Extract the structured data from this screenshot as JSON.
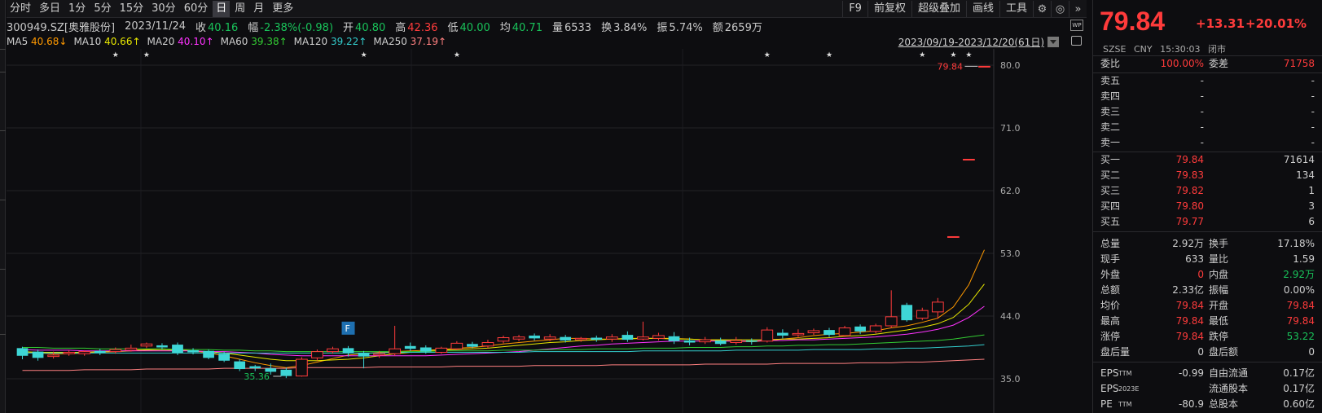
{
  "toolbar": {
    "periods": [
      "分时",
      "多日",
      "1分",
      "5分",
      "15分",
      "30分",
      "60分",
      "日",
      "周",
      "月",
      "更多"
    ],
    "active_period": "日",
    "right_buttons": [
      "F9",
      "前复权",
      "超级叠加",
      "画线",
      "工具"
    ],
    "icons": [
      "gear-icon",
      "compass-icon",
      "double-chevron-right-icon"
    ]
  },
  "info": {
    "code": "300949.SZ[奥雅股份]",
    "date": "2023/11/24",
    "close_label": "收",
    "close": "40.16",
    "amp_label": "幅",
    "amp": "-2.38%(-0.98)",
    "open_label": "开",
    "open": "40.80",
    "high_label": "高",
    "high": "42.36",
    "low_label": "低",
    "low": "40.00",
    "avg_label": "均",
    "avg": "40.71",
    "vol_label": "量",
    "vol": "6533",
    "turnover_label": "换",
    "turnover": "3.84%",
    "swing_label": "振",
    "swing": "5.74%",
    "amount_label": "额",
    "amount": "2659万",
    "wp_icon": "WP"
  },
  "ma": [
    {
      "label": "MA5",
      "value": "40.68↓",
      "color": "#ff9900"
    },
    {
      "label": "MA10",
      "value": "40.66↑",
      "color": "#e8e800"
    },
    {
      "label": "MA20",
      "value": "40.10↑",
      "color": "#ff33ff"
    },
    {
      "label": "MA60",
      "value": "39.38↑",
      "color": "#33cc33"
    },
    {
      "label": "MA120",
      "value": "39.22↑",
      "color": "#33cccc"
    },
    {
      "label": "MA250",
      "value": "37.19↑",
      "color": "#ff8080"
    }
  ],
  "date_range": "2023/09/19-2023/12/20(61日)",
  "chart_data": {
    "type": "candlestick",
    "y_ticks": [
      "80.0",
      "71.0",
      "62.0",
      "53.0",
      "44.0",
      "35.0"
    ],
    "ylim": [
      35.0,
      80.0
    ],
    "last_price_label": "79.84",
    "min_price_label": "35.36",
    "f_marker": "F",
    "up_color": "#ff3b3b",
    "down_color": "#3ed6d6",
    "star_marks": [
      "★",
      "★",
      "★",
      "★",
      "★",
      "★",
      "★",
      "★",
      "★"
    ],
    "candles": [
      {
        "o": 39.4,
        "c": 38.3,
        "h": 39.6,
        "l": 37.8
      },
      {
        "o": 38.9,
        "c": 38.0,
        "h": 39.2,
        "l": 37.6
      },
      {
        "o": 38.2,
        "c": 38.4,
        "h": 38.9,
        "l": 37.9
      },
      {
        "o": 38.6,
        "c": 38.8,
        "h": 39.1,
        "l": 38.3
      },
      {
        "o": 38.6,
        "c": 38.9,
        "h": 39.1,
        "l": 38.3
      },
      {
        "o": 39.0,
        "c": 38.7,
        "h": 39.3,
        "l": 38.4
      },
      {
        "o": 38.9,
        "c": 39.2,
        "h": 39.5,
        "l": 38.6
      },
      {
        "o": 39.1,
        "c": 39.4,
        "h": 39.9,
        "l": 38.9
      },
      {
        "o": 39.7,
        "c": 40.0,
        "h": 40.2,
        "l": 39.4
      },
      {
        "o": 39.8,
        "c": 39.5,
        "h": 40.1,
        "l": 39.2
      },
      {
        "o": 39.9,
        "c": 38.7,
        "h": 40.2,
        "l": 38.4
      },
      {
        "o": 39.1,
        "c": 38.8,
        "h": 39.4,
        "l": 38.5
      },
      {
        "o": 39.0,
        "c": 38.0,
        "h": 39.2,
        "l": 37.8
      },
      {
        "o": 38.6,
        "c": 37.6,
        "h": 38.9,
        "l": 37.4
      },
      {
        "o": 37.5,
        "c": 36.4,
        "h": 37.8,
        "l": 36.1
      },
      {
        "o": 36.8,
        "c": 36.5,
        "h": 37.0,
        "l": 36.1
      },
      {
        "o": 36.5,
        "c": 36.0,
        "h": 37.2,
        "l": 35.6
      },
      {
        "o": 36.3,
        "c": 35.4,
        "h": 36.6,
        "l": 35.1
      },
      {
        "o": 35.4,
        "c": 37.8,
        "h": 38.1,
        "l": 35.3
      },
      {
        "o": 38.0,
        "c": 38.9,
        "h": 39.2,
        "l": 37.6
      },
      {
        "o": 38.9,
        "c": 39.3,
        "h": 39.6,
        "l": 38.6
      },
      {
        "o": 39.4,
        "c": 38.7,
        "h": 39.7,
        "l": 38.2
      },
      {
        "o": 38.7,
        "c": 38.2,
        "h": 39.0,
        "l": 36.5
      },
      {
        "o": 38.4,
        "c": 38.6,
        "h": 39.0,
        "l": 38.0
      },
      {
        "o": 38.6,
        "c": 39.3,
        "h": 42.6,
        "l": 38.3
      },
      {
        "o": 39.7,
        "c": 39.3,
        "h": 40.2,
        "l": 39.0
      },
      {
        "o": 39.5,
        "c": 38.9,
        "h": 39.8,
        "l": 38.6
      },
      {
        "o": 38.8,
        "c": 39.4,
        "h": 39.6,
        "l": 38.6
      },
      {
        "o": 39.3,
        "c": 40.1,
        "h": 40.4,
        "l": 39.1
      },
      {
        "o": 40.0,
        "c": 39.6,
        "h": 40.3,
        "l": 39.4
      },
      {
        "o": 39.7,
        "c": 40.2,
        "h": 40.6,
        "l": 39.4
      },
      {
        "o": 40.4,
        "c": 40.9,
        "h": 41.2,
        "l": 40.1
      },
      {
        "o": 40.7,
        "c": 41.0,
        "h": 41.3,
        "l": 40.4
      },
      {
        "o": 41.2,
        "c": 40.8,
        "h": 41.5,
        "l": 40.5
      },
      {
        "o": 40.7,
        "c": 41.0,
        "h": 41.4,
        "l": 40.4
      },
      {
        "o": 41.0,
        "c": 40.5,
        "h": 41.3,
        "l": 40.2
      },
      {
        "o": 40.6,
        "c": 40.8,
        "h": 41.0,
        "l": 40.3
      },
      {
        "o": 40.9,
        "c": 40.6,
        "h": 41.2,
        "l": 40.3
      },
      {
        "o": 40.7,
        "c": 41.0,
        "h": 41.4,
        "l": 40.3
      },
      {
        "o": 41.3,
        "c": 40.6,
        "h": 41.8,
        "l": 40.3
      },
      {
        "o": 40.7,
        "c": 41.0,
        "h": 43.2,
        "l": 40.5
      },
      {
        "o": 40.8,
        "c": 41.2,
        "h": 41.6,
        "l": 40.5
      },
      {
        "o": 41.1,
        "c": 40.4,
        "h": 41.7,
        "l": 40.0
      },
      {
        "o": 40.5,
        "c": 40.2,
        "h": 40.9,
        "l": 39.8
      },
      {
        "o": 40.3,
        "c": 40.6,
        "h": 41.0,
        "l": 40.0
      },
      {
        "o": 40.5,
        "c": 40.0,
        "h": 40.9,
        "l": 39.8
      },
      {
        "o": 40.2,
        "c": 40.5,
        "h": 41.0,
        "l": 39.9
      },
      {
        "o": 40.5,
        "c": 40.3,
        "h": 40.8,
        "l": 39.9
      },
      {
        "o": 40.4,
        "c": 42.0,
        "h": 42.4,
        "l": 40.2
      },
      {
        "o": 41.6,
        "c": 41.2,
        "h": 42.1,
        "l": 40.8
      },
      {
        "o": 41.3,
        "c": 41.5,
        "h": 42.1,
        "l": 41.0
      },
      {
        "o": 41.6,
        "c": 41.9,
        "h": 42.2,
        "l": 41.3
      },
      {
        "o": 42.0,
        "c": 41.3,
        "h": 42.3,
        "l": 41.0
      },
      {
        "o": 41.2,
        "c": 42.3,
        "h": 42.6,
        "l": 41.0
      },
      {
        "o": 42.5,
        "c": 41.8,
        "h": 42.8,
        "l": 41.4
      },
      {
        "o": 41.8,
        "c": 42.6,
        "h": 42.9,
        "l": 41.5
      },
      {
        "o": 42.6,
        "c": 43.9,
        "h": 47.7,
        "l": 42.3
      },
      {
        "o": 45.6,
        "c": 43.4,
        "h": 45.9,
        "l": 43.2
      },
      {
        "o": 43.7,
        "c": 44.8,
        "h": 45.2,
        "l": 43.4
      },
      {
        "o": 44.6,
        "c": 46.0,
        "h": 46.6,
        "l": 43.6
      },
      {
        "o": 55.4,
        "c": 55.4,
        "h": 55.4,
        "l": 55.4
      },
      {
        "o": 66.5,
        "c": 66.5,
        "h": 66.5,
        "l": 66.5
      },
      {
        "o": 79.84,
        "c": 79.84,
        "h": 79.84,
        "l": 79.84
      }
    ],
    "ma_lines": {
      "ma5": [
        38.9,
        38.7,
        38.6,
        38.6,
        38.7,
        38.8,
        38.9,
        39.1,
        39.2,
        39.3,
        39.2,
        39.0,
        38.7,
        38.3,
        37.8,
        37.3,
        36.9,
        36.6,
        36.9,
        37.4,
        37.9,
        38.4,
        38.6,
        38.8,
        38.9,
        39.0,
        39.1,
        39.2,
        39.4,
        39.5,
        39.7,
        40.0,
        40.2,
        40.4,
        40.6,
        40.8,
        40.8,
        40.7,
        40.7,
        40.7,
        40.8,
        40.8,
        40.8,
        40.7,
        40.6,
        40.5,
        40.4,
        40.3,
        40.5,
        40.7,
        40.9,
        41.2,
        41.4,
        41.5,
        41.7,
        41.9,
        42.3,
        42.6,
        43.1,
        43.7,
        45.3,
        48.5,
        53.5
      ],
      "ma10": [
        38.9,
        38.8,
        38.8,
        38.8,
        38.8,
        38.9,
        38.9,
        39.0,
        39.1,
        39.1,
        39.1,
        39.0,
        38.9,
        38.7,
        38.4,
        38.1,
        37.8,
        37.6,
        37.6,
        37.6,
        37.7,
        37.8,
        38.0,
        38.3,
        38.6,
        38.8,
        39.0,
        39.1,
        39.2,
        39.3,
        39.4,
        39.6,
        39.8,
        40.0,
        40.2,
        40.3,
        40.5,
        40.6,
        40.7,
        40.8,
        40.8,
        40.8,
        40.7,
        40.7,
        40.6,
        40.6,
        40.6,
        40.6,
        40.6,
        40.7,
        40.7,
        40.8,
        40.9,
        41.1,
        41.2,
        41.4,
        41.7,
        42.0,
        42.4,
        42.9,
        43.8,
        45.7,
        48.6
      ],
      "ma20": [
        39.2,
        39.1,
        39.1,
        39.1,
        39.0,
        39.0,
        39.0,
        39.0,
        39.0,
        39.0,
        39.0,
        39.0,
        38.9,
        38.9,
        38.8,
        38.7,
        38.5,
        38.4,
        38.3,
        38.3,
        38.3,
        38.3,
        38.3,
        38.3,
        38.3,
        38.3,
        38.3,
        38.4,
        38.5,
        38.6,
        38.7,
        38.8,
        38.9,
        39.1,
        39.3,
        39.5,
        39.7,
        39.8,
        40.0,
        40.1,
        40.2,
        40.3,
        40.4,
        40.4,
        40.4,
        40.4,
        40.4,
        40.4,
        40.5,
        40.5,
        40.6,
        40.6,
        40.7,
        40.8,
        40.9,
        41.0,
        41.2,
        41.4,
        41.7,
        42.1,
        42.7,
        43.8,
        45.4
      ],
      "ma60": [
        39.5,
        39.5,
        39.4,
        39.4,
        39.4,
        39.3,
        39.3,
        39.3,
        39.3,
        39.3,
        39.2,
        39.2,
        39.2,
        39.1,
        39.1,
        39.0,
        39.0,
        38.9,
        38.9,
        38.9,
        38.9,
        38.9,
        38.9,
        38.9,
        38.9,
        38.9,
        38.9,
        39.0,
        39.0,
        39.0,
        39.0,
        39.1,
        39.1,
        39.1,
        39.2,
        39.2,
        39.2,
        39.3,
        39.3,
        39.3,
        39.4,
        39.4,
        39.4,
        39.5,
        39.5,
        39.5,
        39.6,
        39.6,
        39.7,
        39.7,
        39.8,
        39.8,
        39.9,
        39.9,
        40.0,
        40.1,
        40.2,
        40.3,
        40.4,
        40.5,
        40.7,
        41.0,
        41.3
      ],
      "ma120": [
        38.7,
        38.7,
        38.7,
        38.7,
        38.7,
        38.7,
        38.7,
        38.7,
        38.7,
        38.7,
        38.7,
        38.7,
        38.7,
        38.7,
        38.7,
        38.7,
        38.7,
        38.7,
        38.7,
        38.7,
        38.7,
        38.7,
        38.7,
        38.7,
        38.8,
        38.8,
        38.8,
        38.8,
        38.8,
        38.8,
        38.8,
        38.8,
        38.8,
        38.9,
        38.9,
        38.9,
        38.9,
        38.9,
        38.9,
        38.9,
        39.0,
        39.0,
        39.0,
        39.0,
        39.0,
        39.0,
        39.1,
        39.1,
        39.1,
        39.1,
        39.1,
        39.2,
        39.2,
        39.2,
        39.2,
        39.3,
        39.3,
        39.4,
        39.4,
        39.5,
        39.6,
        39.7,
        39.9
      ],
      "ma250": [
        36.2,
        36.2,
        36.2,
        36.2,
        36.3,
        36.3,
        36.3,
        36.3,
        36.4,
        36.4,
        36.4,
        36.4,
        36.4,
        36.5,
        36.5,
        36.5,
        36.5,
        36.5,
        36.6,
        36.6,
        36.6,
        36.6,
        36.6,
        36.7,
        36.7,
        36.7,
        36.7,
        36.7,
        36.8,
        36.8,
        36.8,
        36.8,
        36.8,
        36.9,
        36.9,
        36.9,
        36.9,
        36.9,
        37.0,
        37.0,
        37.0,
        37.0,
        37.0,
        37.0,
        37.1,
        37.1,
        37.1,
        37.1,
        37.1,
        37.2,
        37.2,
        37.2,
        37.2,
        37.2,
        37.3,
        37.3,
        37.3,
        37.4,
        37.4,
        37.5,
        37.6,
        37.7,
        37.8
      ]
    }
  },
  "quote": {
    "price": "79.84",
    "change": "+13.31",
    "change_pct": "+20.01%",
    "exchange": "SZSE",
    "currency": "CNY",
    "time": "15:30:03",
    "status": "闭市",
    "weibi_label": "委比",
    "weibi": "100.00%",
    "weicha_label": "委差",
    "weicha": "71758",
    "asks": [
      {
        "label": "卖五",
        "price": "-",
        "vol": "-"
      },
      {
        "label": "卖四",
        "price": "-",
        "vol": "-"
      },
      {
        "label": "卖三",
        "price": "-",
        "vol": "-"
      },
      {
        "label": "卖二",
        "price": "-",
        "vol": "-"
      },
      {
        "label": "卖一",
        "price": "-",
        "vol": "-"
      }
    ],
    "bids": [
      {
        "label": "买一",
        "price": "79.84",
        "vol": "71614"
      },
      {
        "label": "买二",
        "price": "79.83",
        "vol": "134"
      },
      {
        "label": "买三",
        "price": "79.82",
        "vol": "1"
      },
      {
        "label": "买四",
        "price": "79.80",
        "vol": "3"
      },
      {
        "label": "买五",
        "price": "79.77",
        "vol": "6"
      }
    ],
    "stats": [
      {
        "l1": "总量",
        "v1": "2.92万",
        "c1": "#cfcfcf",
        "l2": "换手",
        "v2": "17.18%",
        "c2": "#cfcfcf"
      },
      {
        "l1": "现手",
        "v1": "633",
        "c1": "#cfcfcf",
        "l2": "量比",
        "v2": "1.59",
        "c2": "#cfcfcf"
      },
      {
        "l1": "外盘",
        "v1": "0",
        "c1": "#ff3b3b",
        "l2": "内盘",
        "v2": "2.92万",
        "c2": "#19c35a"
      },
      {
        "l1": "总额",
        "v1": "2.33亿",
        "c1": "#cfcfcf",
        "l2": "振幅",
        "v2": "0.00%",
        "c2": "#cfcfcf"
      },
      {
        "l1": "均价",
        "v1": "79.84",
        "c1": "#ff3b3b",
        "l2": "开盘",
        "v2": "79.84",
        "c2": "#ff3b3b"
      },
      {
        "l1": "最高",
        "v1": "79.84",
        "c1": "#ff3b3b",
        "l2": "最低",
        "v2": "79.84",
        "c2": "#ff3b3b"
      },
      {
        "l1": "涨停",
        "v1": "79.84",
        "c1": "#ff3b3b",
        "l2": "跌停",
        "v2": "53.22",
        "c2": "#19c35a"
      },
      {
        "l1": "盘后量",
        "v1": "0",
        "c1": "#cfcfcf",
        "l2": "盘后额",
        "v2": "0",
        "c2": "#cfcfcf"
      }
    ],
    "fund": [
      {
        "l1": "EPS",
        "sup1": "TTM",
        "v1": "-0.99",
        "l2": "自由流通",
        "v2": "0.17亿"
      },
      {
        "l1": "EPS",
        "sup1": "2023E",
        "v1": "",
        "l2": "流通股本",
        "v2": "0.17亿"
      },
      {
        "l1": "PE",
        "sup1": "TTM",
        "v1": "-80.9",
        "l2": "总股本",
        "v2": "0.60亿"
      }
    ]
  }
}
